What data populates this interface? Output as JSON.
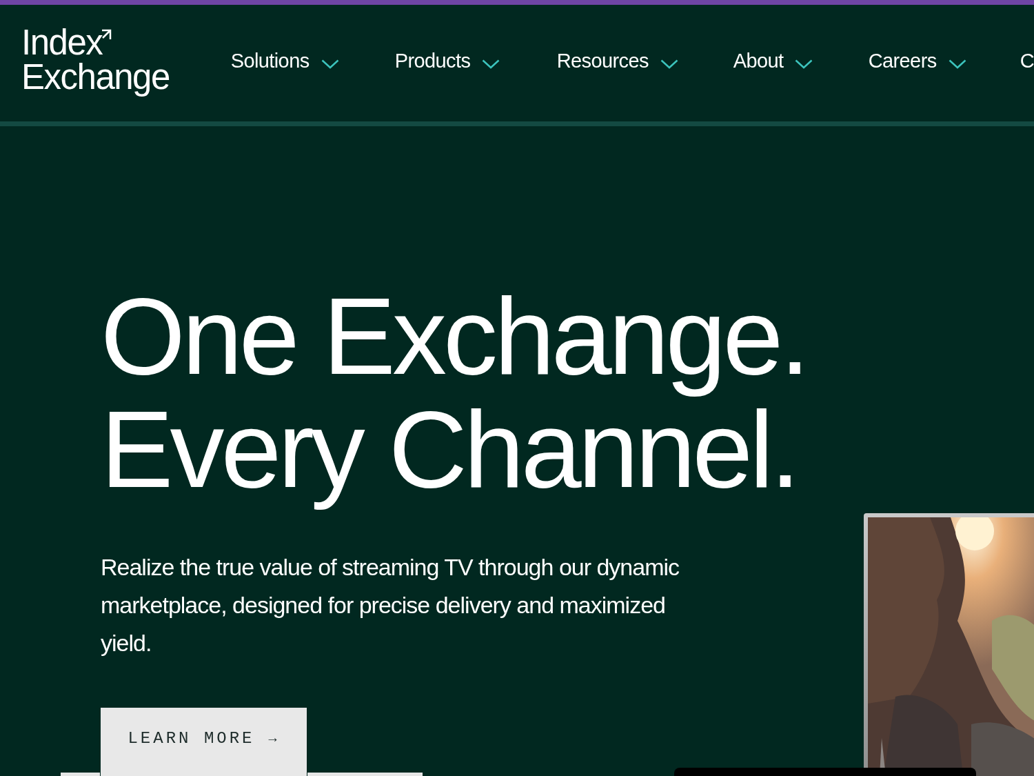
{
  "header": {
    "logo": {
      "line_1": "Index",
      "line_2": "Exchange"
    },
    "nav": [
      {
        "label": "Solutions",
        "dropdown": true
      },
      {
        "label": "Products",
        "dropdown": true
      },
      {
        "label": "Resources",
        "dropdown": true
      },
      {
        "label": "About",
        "dropdown": true
      },
      {
        "label": "Careers",
        "dropdown": true
      },
      {
        "label": "C",
        "dropdown": false
      }
    ]
  },
  "hero": {
    "headline": [
      "One Exchange.",
      "Every Channel."
    ],
    "text": "Realize the true value of streaming TV through our dynamic marketplace, designed for precise delivery and maximized yield.",
    "button": {
      "label": "LEARN MORE",
      "arrow": "→"
    }
  }
}
